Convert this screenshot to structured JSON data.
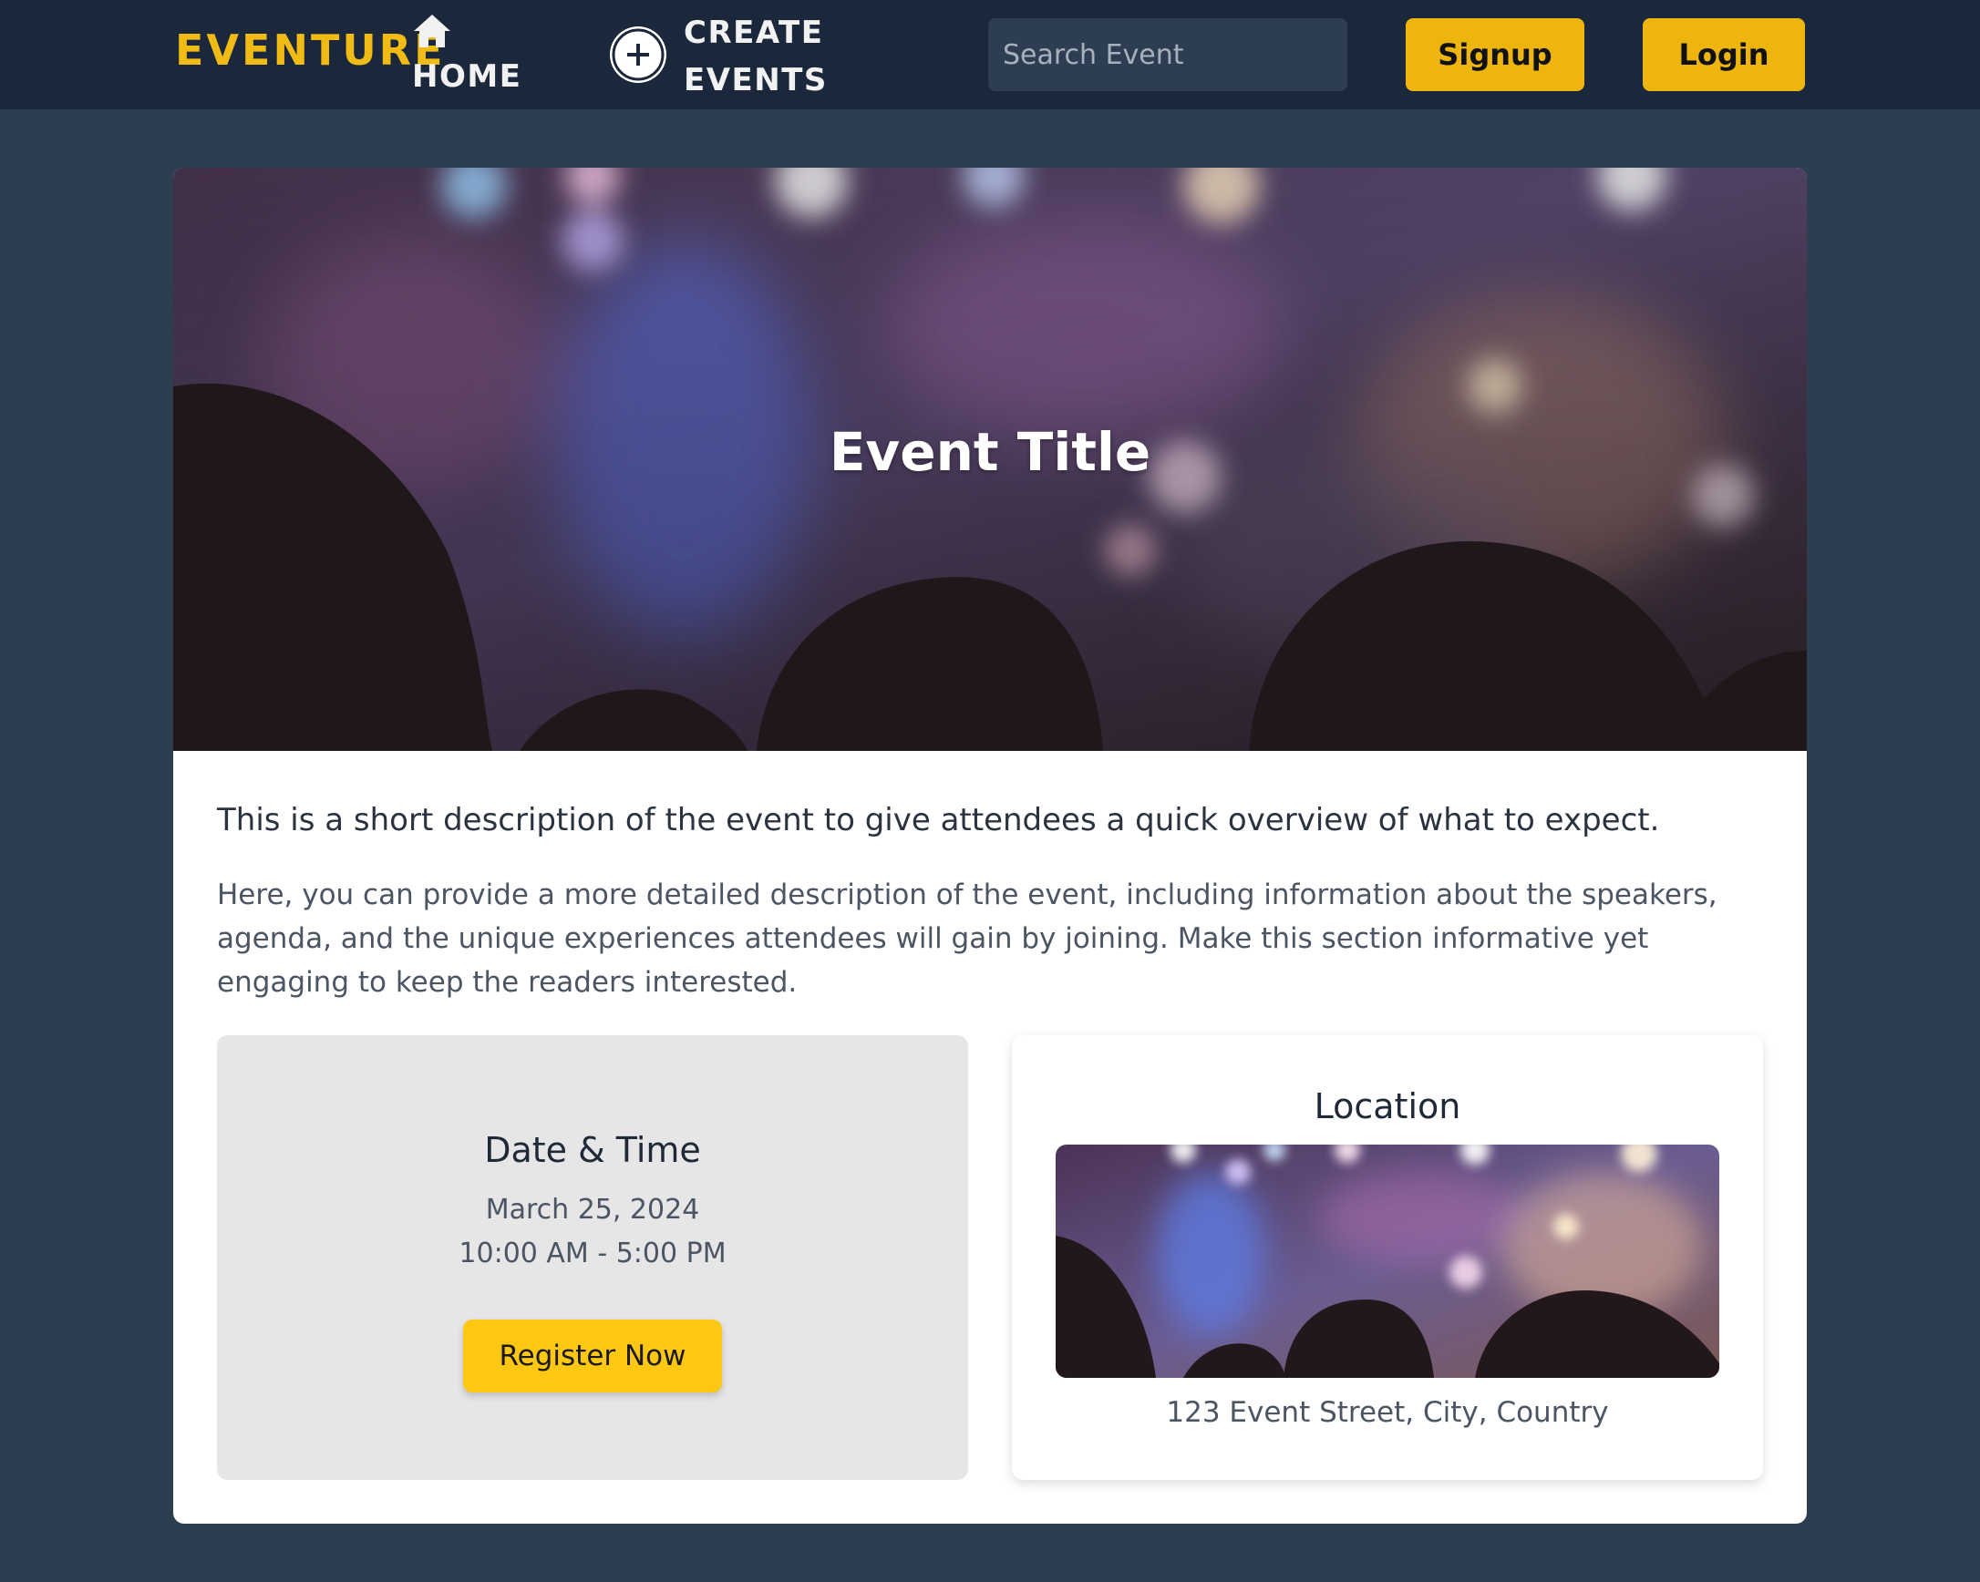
{
  "navbar": {
    "brand": "EVENTURE",
    "home_label": "HOME",
    "create_label_line1": "CREATE",
    "create_label_line2": "EVENTS",
    "search_placeholder": "Search Event",
    "signup_label": "Signup",
    "login_label": "Login"
  },
  "event": {
    "title": "Event Title",
    "short_description": "This is a short description of the event to give attendees a quick overview of what to expect.",
    "long_description": "Here, you can provide a more detailed description of the event, including information about the speakers, agenda, and the unique experiences attendees will gain by joining. Make this section informative yet engaging to keep the readers interested.",
    "date_time": {
      "heading": "Date & Time",
      "date": "March 25, 2024",
      "time": "10:00 AM - 5:00 PM",
      "register_label": "Register Now"
    },
    "location": {
      "heading": "Location",
      "address": "123 Event Street, City, Country"
    }
  },
  "icons": {
    "home": "home-icon",
    "create": "plus-circle-icon"
  },
  "colors": {
    "navbar_bg": "#1b273b",
    "page_bg": "#2d3e51",
    "brand": "#f0bb15",
    "nav_button": "#eeb50e",
    "register_button": "#fdc713"
  }
}
